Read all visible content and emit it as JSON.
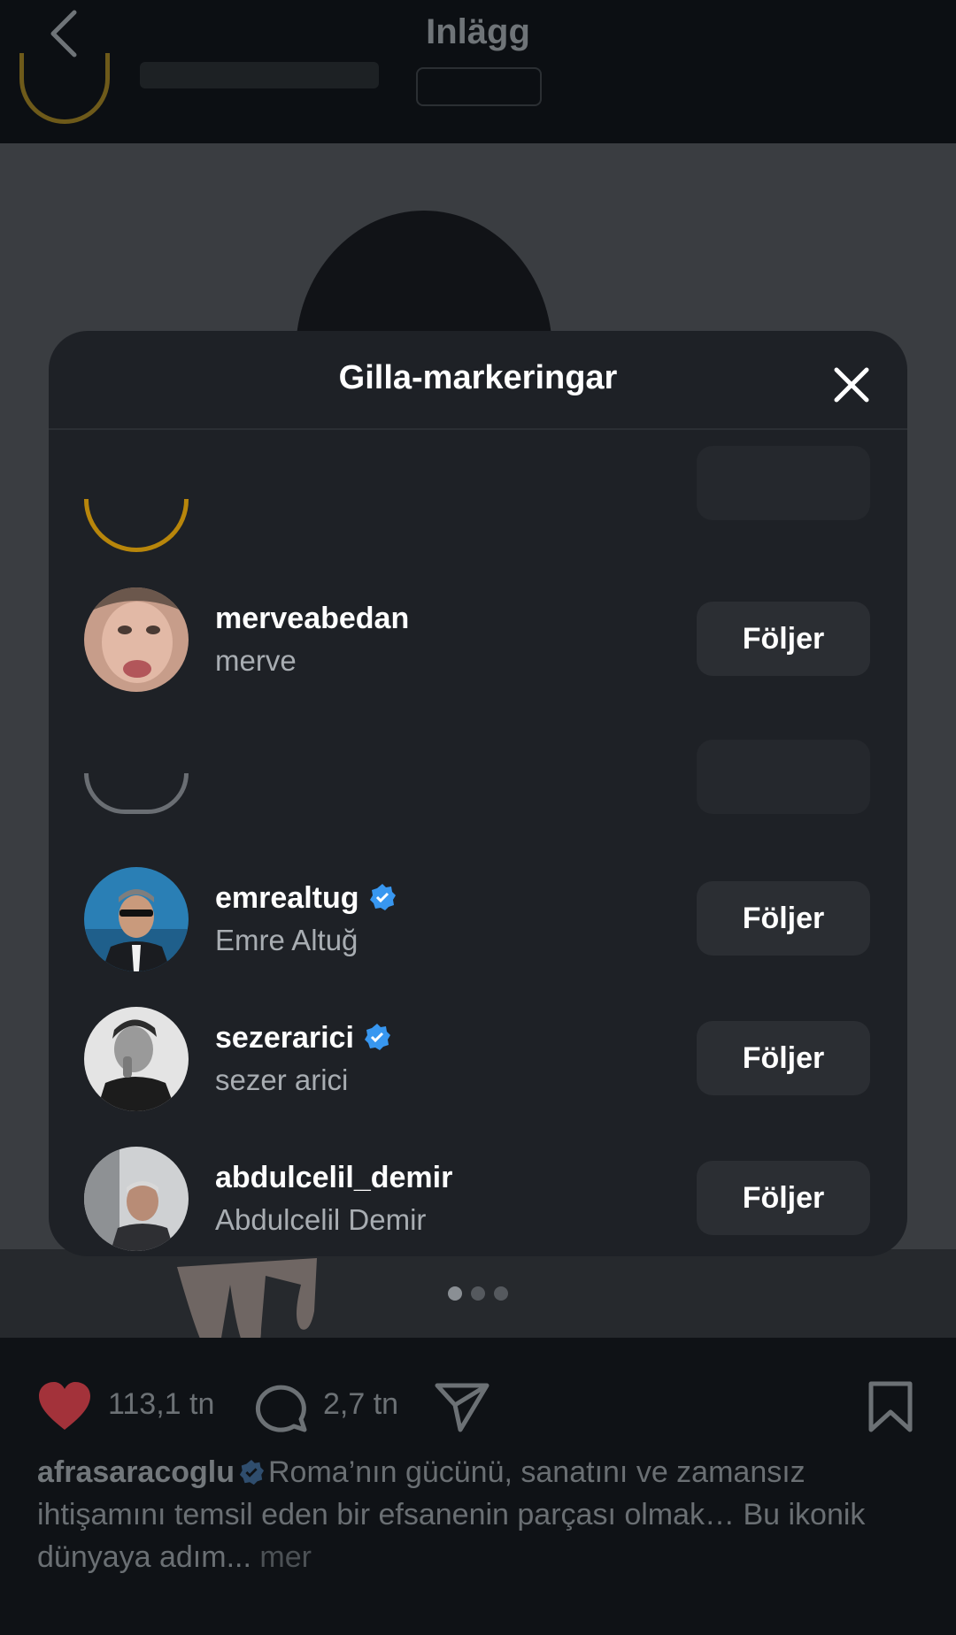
{
  "header": {
    "title": "Inlägg"
  },
  "post": {
    "likes": "113,1 tn",
    "comments": "2,7 tn",
    "carousel_dots": 3,
    "caption_user": "afrasaracoglu",
    "caption_text": "Roma’nın gücünü, sanatını ve zamansız ihtişamını temsil eden bir efsanenin parçası olmak… Bu ikonik dünyaya adım...",
    "caption_more": "mer"
  },
  "modal": {
    "title": "Gilla-markeringar",
    "follow_label": "Följer",
    "items": [
      {
        "username": "merveabedan",
        "fullname": "merve",
        "verified": false
      },
      {
        "username": "emrealtug",
        "fullname": "Emre Altuğ",
        "verified": true
      },
      {
        "username": "sezerarici",
        "fullname": "sezer arici",
        "verified": true
      },
      {
        "username": "abdulcelil_demir",
        "fullname": "Abdulcelil Demir",
        "verified": false
      }
    ]
  },
  "colors": {
    "modal_bg": "#1e2126",
    "button_bg": "#2b2e33",
    "verified_blue": "#3897f0",
    "like_red": "#a3323a"
  },
  "icons": [
    "back-icon",
    "close-icon",
    "verified-badge-icon",
    "heart-icon",
    "comment-icon",
    "share-icon",
    "bookmark-icon"
  ]
}
